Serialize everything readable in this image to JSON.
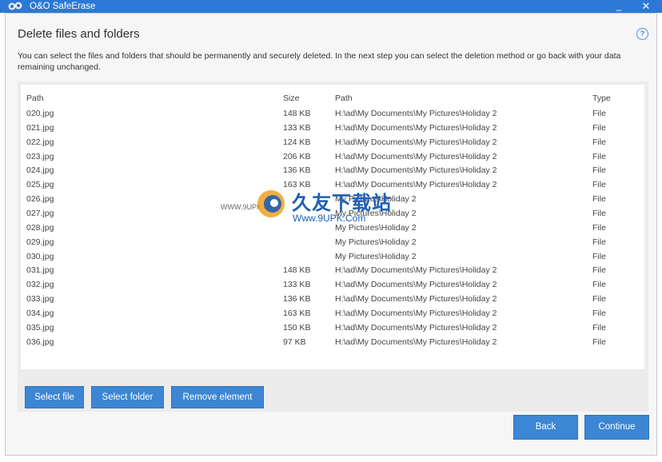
{
  "titlebar": {
    "title": "O&O SafeErase",
    "minimize": "_",
    "close": "✕",
    "icon": "oo-safeerase-app-icon"
  },
  "page": {
    "heading": "Delete files and folders",
    "help": "?",
    "description": "You can select the files and folders that should be permanently and securely deleted. In the next step you can select the deletion method or go back with your data remaining unchanged."
  },
  "table": {
    "headers": [
      "Path",
      "Size",
      "Path",
      "Type"
    ],
    "rows": [
      [
        "020.jpg",
        "148 KB",
        "H:\\ad\\My Documents\\My Pictures\\Holiday 2",
        "File"
      ],
      [
        "021.jpg",
        "133 KB",
        "H:\\ad\\My Documents\\My Pictures\\Holiday 2",
        "File"
      ],
      [
        "022.jpg",
        "124 KB",
        "H:\\ad\\My Documents\\My Pictures\\Holiday 2",
        "File"
      ],
      [
        "023.jpg",
        "206 KB",
        "H:\\ad\\My Documents\\My Pictures\\Holiday 2",
        "File"
      ],
      [
        "024.jpg",
        "136 KB",
        "H:\\ad\\My Documents\\My Pictures\\Holiday 2",
        "File"
      ],
      [
        "025.jpg",
        "163 KB",
        "H:\\ad\\My Documents\\My Pictures\\Holiday 2",
        "File"
      ],
      [
        "026.jpg",
        "",
        "My Pictures\\Holiday 2",
        "File"
      ],
      [
        "027.jpg",
        "",
        "My Pictures\\Holiday 2",
        "File"
      ],
      [
        "028.jpg",
        "",
        "My Pictures\\Holiday 2",
        "File"
      ],
      [
        "029.jpg",
        "",
        "My Pictures\\Holiday 2",
        "File"
      ],
      [
        "030.jpg",
        "",
        "My Pictures\\Holiday 2",
        "File"
      ],
      [
        "031.jpg",
        "148 KB",
        "H:\\ad\\My Documents\\My Pictures\\Holiday 2",
        "File"
      ],
      [
        "032.jpg",
        "133 KB",
        "H:\\ad\\My Documents\\My Pictures\\Holiday 2",
        "File"
      ],
      [
        "033.jpg",
        "136 KB",
        "H:\\ad\\My Documents\\My Pictures\\Holiday 2",
        "File"
      ],
      [
        "034.jpg",
        "163 KB",
        "H:\\ad\\My Documents\\My Pictures\\Holiday 2",
        "File"
      ],
      [
        "035.jpg",
        "150 KB",
        "H:\\ad\\My Documents\\My Pictures\\Holiday 2",
        "File"
      ],
      [
        "036.jpg",
        "97 KB",
        "H:\\ad\\My Documents\\My Pictures\\Holiday 2",
        "File"
      ]
    ]
  },
  "buttons": {
    "select_file": "Select file",
    "select_folder": "Select folder",
    "remove_element": "Remove element",
    "back": "Back",
    "continue": "Continue"
  },
  "watermark": {
    "small": "WWW.9UPK.COM",
    "cn": "久友下载站",
    "url": "Www.9UPK.Com"
  },
  "colors": {
    "titlebar": "#2b78d6",
    "button": "#3c86d3",
    "background": "#f6f6f6",
    "panel": "#ececec"
  }
}
